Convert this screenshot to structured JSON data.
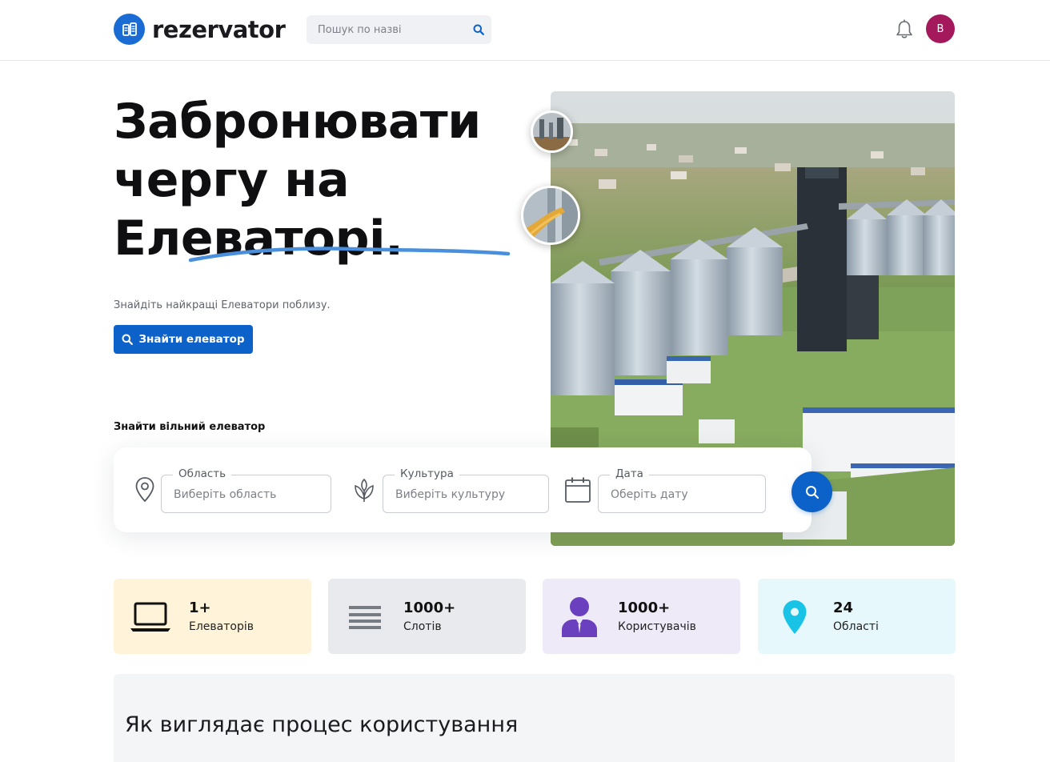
{
  "header": {
    "logo_text": "rezervator",
    "search_placeholder": "Пошук по назві",
    "avatar_initial": "B"
  },
  "hero": {
    "title_lines": [
      "Забронювати",
      "чергу на",
      "Елеваторі."
    ],
    "subtitle": "Знайдіть найкращі Елеватори поблизу.",
    "cta_label": "Знайти елеватор"
  },
  "finder": {
    "label": "Знайти вільний елеватор",
    "fields": [
      {
        "label": "Область",
        "placeholder": "Виберіть область",
        "icon": "map-pin-icon"
      },
      {
        "label": "Культура",
        "placeholder": "Виберіть культуру",
        "icon": "wheat-icon"
      },
      {
        "label": "Дата",
        "placeholder": "Оберіть дату",
        "icon": "calendar-icon"
      }
    ]
  },
  "stats": [
    {
      "value": "1+",
      "label": "Елеваторів",
      "icon": "laptop-icon",
      "bg": "#fff4d9"
    },
    {
      "value": "1000+",
      "label": "Слотів",
      "icon": "lines-icon",
      "bg": "#e9eaed"
    },
    {
      "value": "1000+",
      "label": "Користувачів",
      "icon": "user-icon",
      "bg": "#eeeaf8"
    },
    {
      "value": "24",
      "label": "Області",
      "icon": "location-pin-icon",
      "bg": "#e6f8fc"
    }
  ],
  "process": {
    "title": "Як виглядає процес користування"
  },
  "colors": {
    "primary": "#0d62c9",
    "avatar": "#a3195b",
    "underline": "#4a8fdc"
  }
}
